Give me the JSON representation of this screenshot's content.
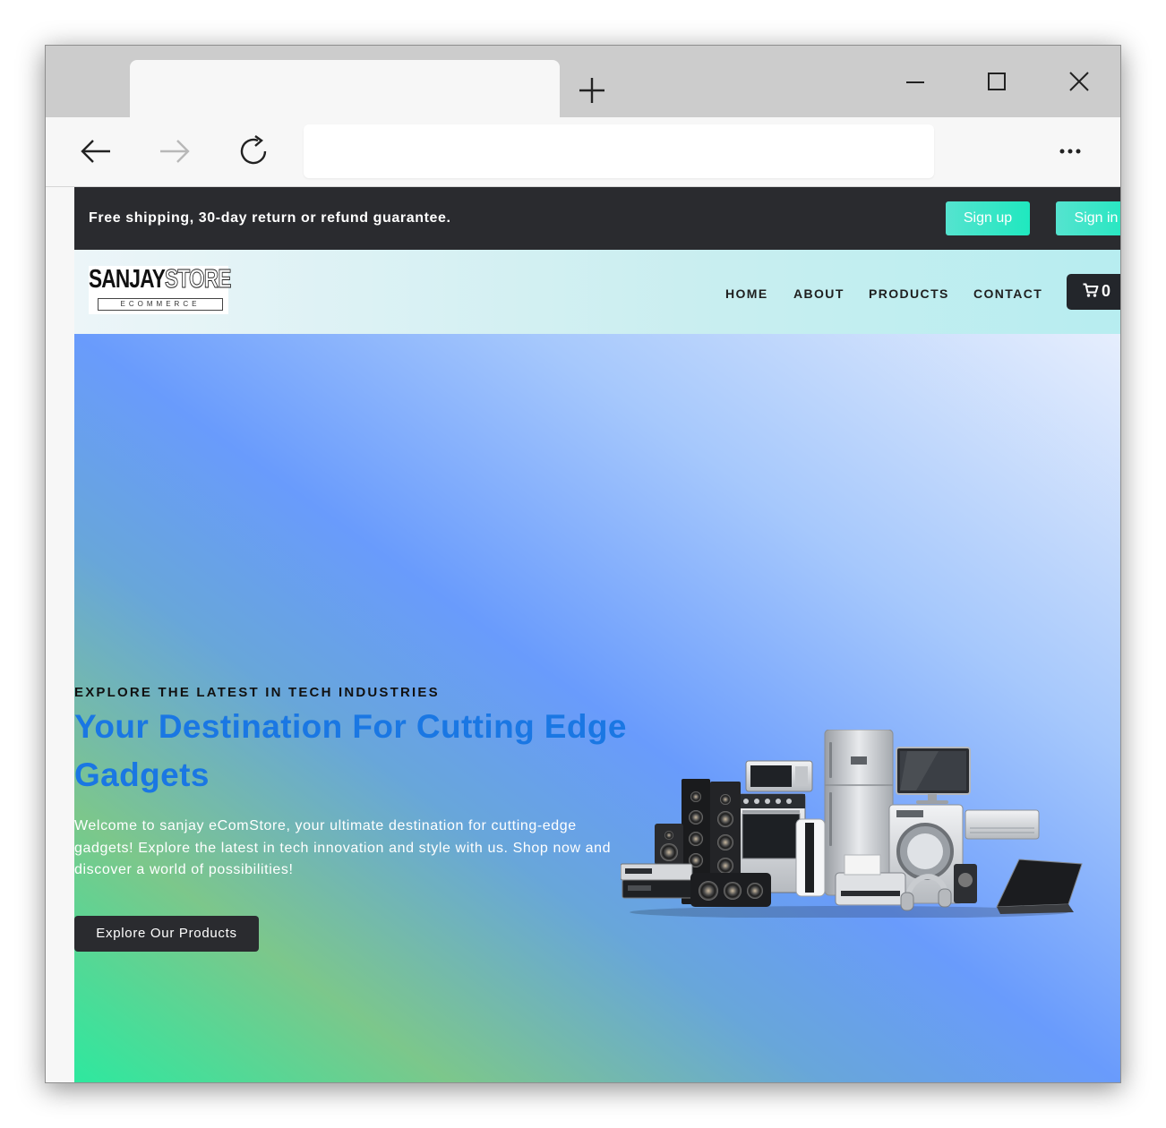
{
  "browser": {
    "tab_title": "",
    "address_value": "",
    "icons": [
      "new-tab-icon",
      "minimize-icon",
      "maximize-icon",
      "close-icon",
      "back-arrow-icon",
      "forward-arrow-icon",
      "reload-icon",
      "more-options-icon"
    ]
  },
  "topbar": {
    "shipping_text": "Free shipping, 30-day return or refund guarantee.",
    "signup_label": "Sign up",
    "signin_label": "Sign in"
  },
  "header": {
    "logo_brand_dark": "SANJAY",
    "logo_brand_light": "STORE",
    "logo_subtitle": "ECOMMERCE",
    "nav": [
      "HOME",
      "ABOUT",
      "PRODUCTS",
      "CONTACT"
    ],
    "cart_icon": "shopping-cart-icon",
    "cart_count": "0"
  },
  "hero": {
    "eyebrow": "EXPLORE THE LATEST IN TECH INDUSTRIES",
    "headline": "Your Destination For Cutting Edge Gadgets",
    "description": "Welcome to sanjay eComStore, your ultimate destination for cutting-edge gadgets! Explore the latest in tech innovation and style with us. Shop now and discover a world of possibilities!",
    "cta_label": "Explore Our Products",
    "image": "electronics-appliances-group"
  },
  "colors": {
    "topbar_bg": "#2a2b2f",
    "accent_teal": "#1fe8bf",
    "headline_blue": "#1a77e3",
    "gradient_green": "#2ee89f",
    "gradient_blue": "#699bfc",
    "gradient_light": "#e6eefd"
  }
}
